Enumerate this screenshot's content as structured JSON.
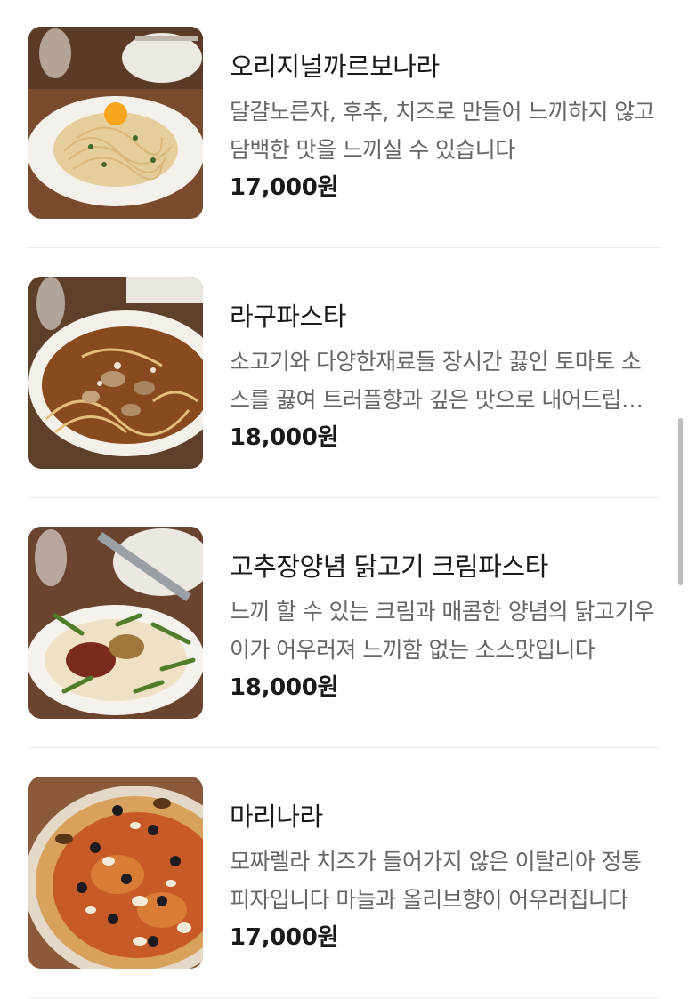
{
  "menu": {
    "items": [
      {
        "name": "오리지널까르보나라",
        "description": "달걀노른자, 후추, 치즈로 만들어 느끼하지 않고 담백한 맛을 느끼실 수 있습니다",
        "price": "17,000원",
        "photo_icon": "carbonara-photo"
      },
      {
        "name": "라구파스타",
        "description": "소고기와 다양한재료들 장시간 끓인 토마토 소스를 끓여 트러플향과 깊은 맛으로 내어드립니다",
        "price": "18,000원",
        "photo_icon": "ragu-pasta-photo"
      },
      {
        "name": "고추장양념 닭고기 크림파스타",
        "description": "느끼 할 수 있는 크림과 매콤한 양념의 닭고기우이가 어우러져 느끼함 없는 소스맛입니다",
        "price": "18,000원",
        "photo_icon": "gochujang-cream-pasta-photo"
      },
      {
        "name": "마리나라",
        "description": "모짜렐라 치즈가 들어가지 않은 이탈리아 정통 피자입니다 마늘과 올리브향이 어우러집니다",
        "price": "17,000원",
        "photo_icon": "marinara-pizza-photo"
      }
    ]
  }
}
